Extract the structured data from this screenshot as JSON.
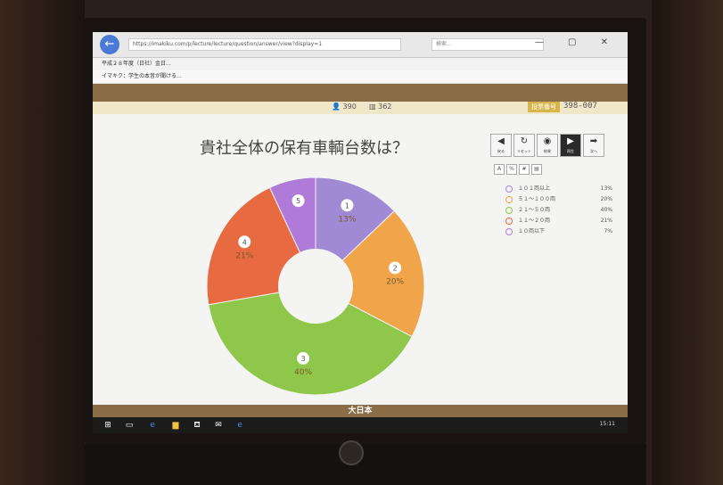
{
  "browser": {
    "url": "https://imakiku.com/p/lecture/lecture/question/answer/view?display=1",
    "tab_label": "平成２８年度（日社）金日...",
    "favorite_label": "イマキク：学生の本音が聞ける...",
    "search_placeholder": "検索...",
    "window_controls": "—  ▢  ✕"
  },
  "header": {
    "participants": "390",
    "responses": "362",
    "badge": "投票番号",
    "code": "398-007"
  },
  "controls": [
    {
      "icon": "◀",
      "label": "戻る"
    },
    {
      "icon": "↻",
      "label": "リセット"
    },
    {
      "icon": "◉",
      "label": "結果"
    },
    {
      "icon": "▶",
      "label": "再生",
      "active": true
    },
    {
      "icon": "➡",
      "label": "次へ"
    }
  ],
  "mini_controls": [
    "A",
    "%",
    "#",
    "▤"
  ],
  "chart_data": {
    "type": "pie",
    "donut": true,
    "title": "貴社全体の保有車輌台数は？",
    "categories": [
      "１０１両以上",
      "５１～１００両",
      "２１～５０両",
      "１１～２０両",
      "１０両以下"
    ],
    "labels": [
      "1",
      "2",
      "3",
      "4",
      "5"
    ],
    "values": [
      13,
      20,
      40,
      21,
      7
    ],
    "value_labels": [
      "13%",
      "20%",
      "40%",
      "21%",
      ""
    ],
    "colors": [
      "#a08ad6",
      "#f0a54a",
      "#8ec74a",
      "#e86a40",
      "#b07ad8"
    ],
    "legend_position": "right"
  },
  "footer": {
    "brand": "大日本"
  },
  "taskbar": {
    "clock": "15:11"
  }
}
